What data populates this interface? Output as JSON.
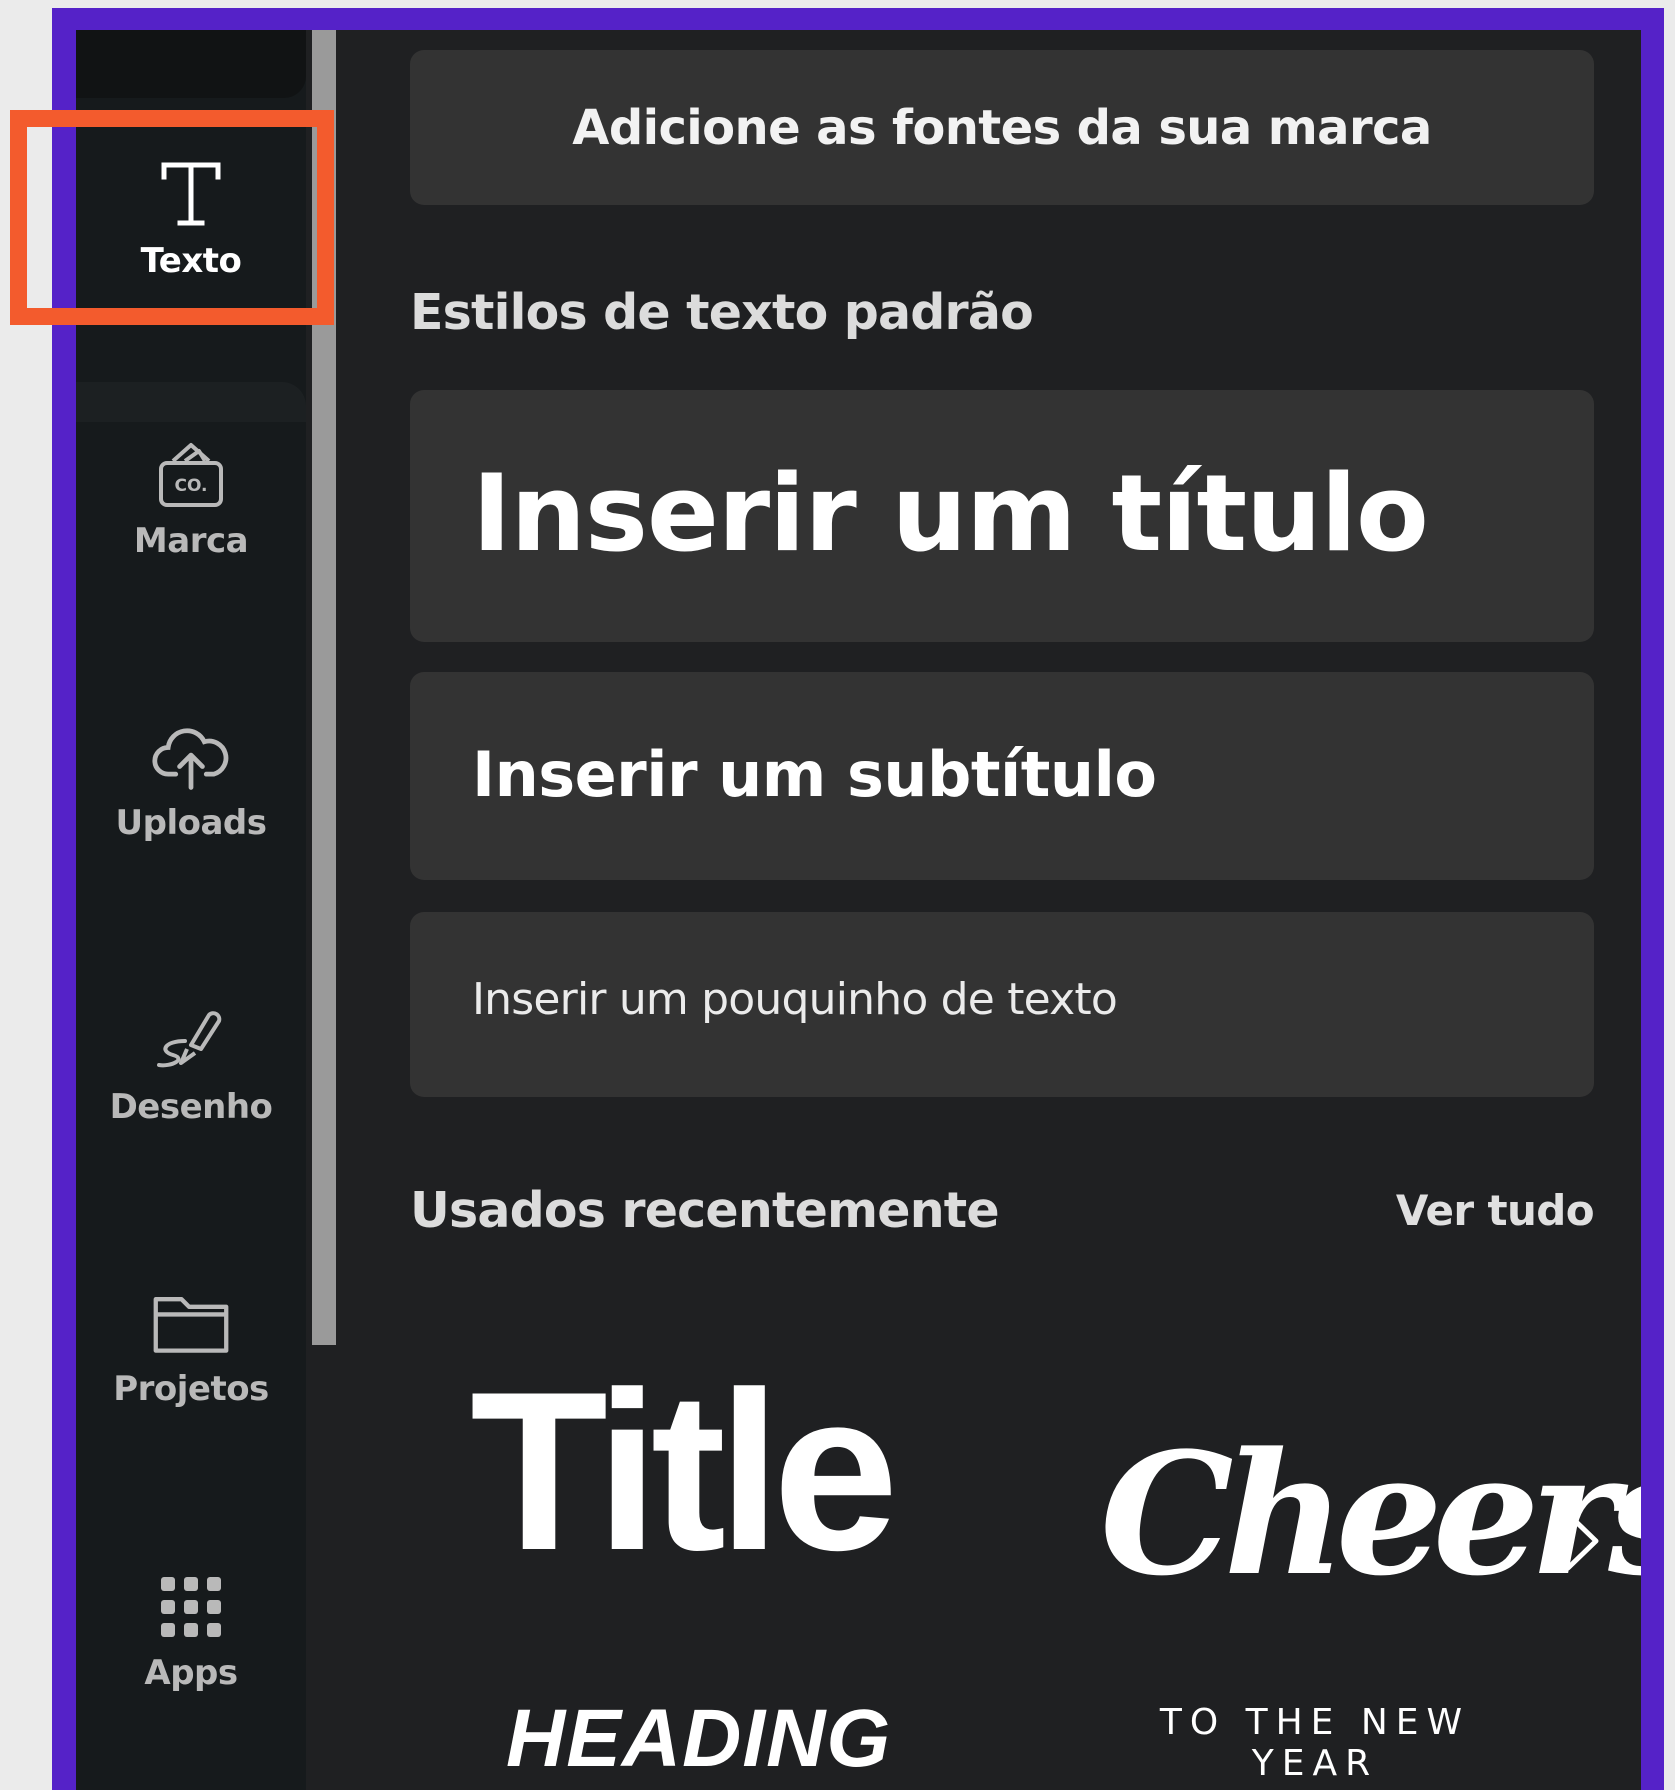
{
  "sidebar": {
    "items": [
      {
        "label": "Texto",
        "icon": "text-icon",
        "active": true
      },
      {
        "label": "Marca",
        "icon": "brand-icon"
      },
      {
        "label": "Uploads",
        "icon": "cloud-upload-icon"
      },
      {
        "label": "Desenho",
        "icon": "draw-icon"
      },
      {
        "label": "Projetos",
        "icon": "folder-icon"
      },
      {
        "label": "Apps",
        "icon": "apps-grid-icon"
      }
    ]
  },
  "main": {
    "brand_fonts_button": "Adicione as fontes da sua marca",
    "default_styles_heading": "Estilos de texto padrão",
    "add_heading": "Inserir um título",
    "add_subheading": "Inserir um subtítulo",
    "add_body": "Inserir um pouquinho de texto",
    "recent_heading": "Usados recentemente",
    "see_all": "Ver tudo",
    "recent_items": {
      "title": "Title",
      "heading": "HEADING",
      "cheers": "Cheers",
      "cheers_sub": "TO THE NEW YEAR"
    }
  },
  "colors": {
    "frame": "#5522c8",
    "highlight": "#f35b2d",
    "panel_bg": "#1f2022",
    "sidebar_bg": "#161a1c",
    "card_bg": "#333333"
  }
}
